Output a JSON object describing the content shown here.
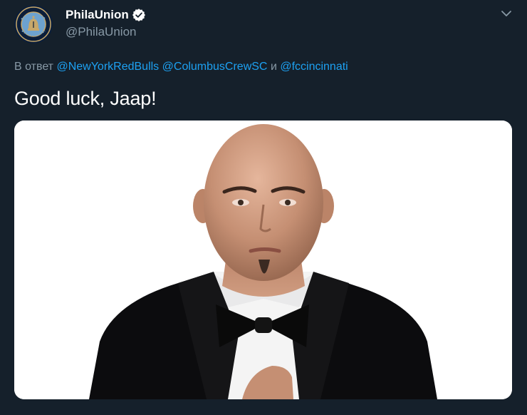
{
  "tweet": {
    "display_name": "PhilaUnion",
    "handle": "@PhilaUnion",
    "reply": {
      "prefix": "В ответ",
      "mentions": [
        "@NewYorkRedBulls",
        "@ColumbusCrewSC",
        "@fccincinnati"
      ],
      "conjunction": "и"
    },
    "text": "Good luck, Jaap!",
    "avatar_icon": "phila-union-crest-icon",
    "verified_icon": "verified-badge-icon",
    "menu_icon": "chevron-down-icon"
  },
  "colors": {
    "background": "#15202b",
    "link": "#1da1f2",
    "secondary_text": "#8899a6",
    "primary_text": "#ffffff"
  }
}
